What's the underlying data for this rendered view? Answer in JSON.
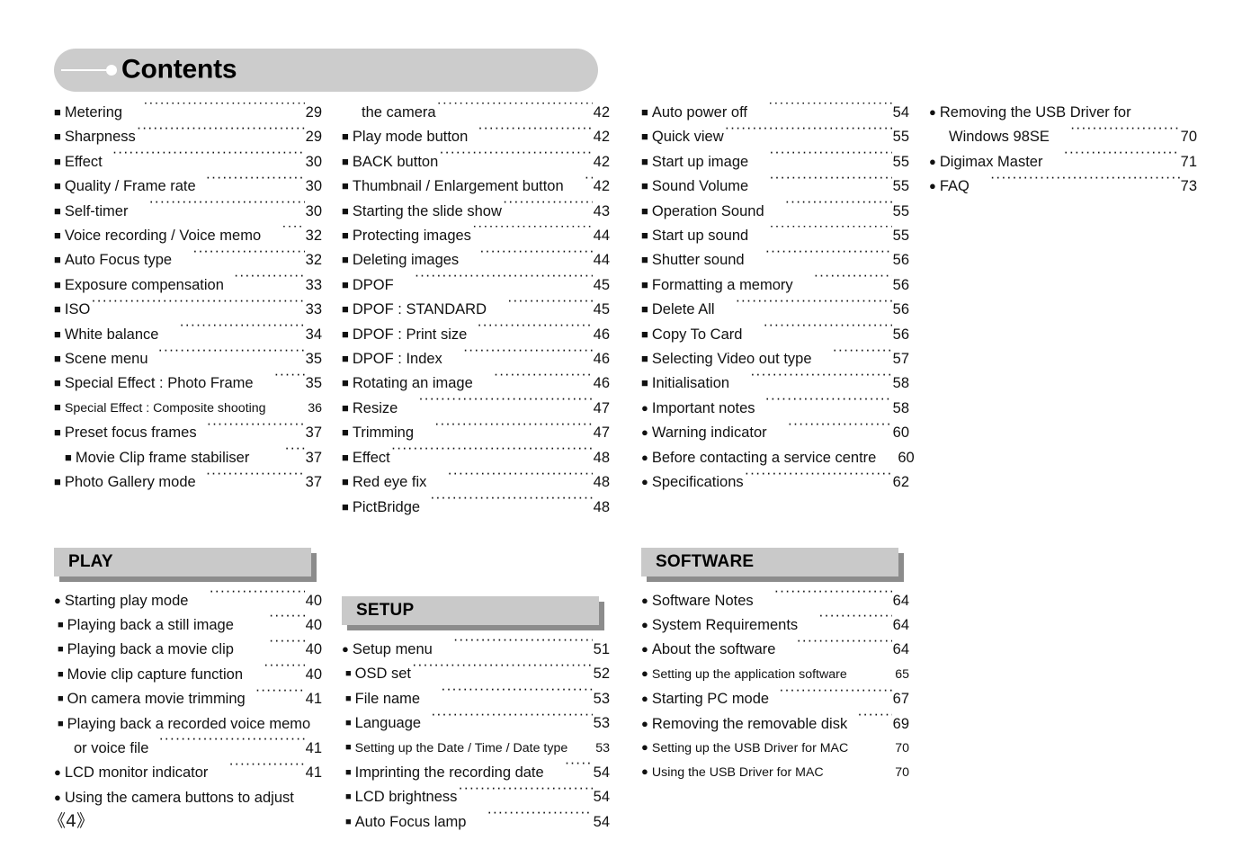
{
  "header": {
    "title": "Contents",
    "decoration": "line-dot-marker"
  },
  "footer": {
    "page_number": "《4》"
  },
  "bullets": {
    "round": "●",
    "square": "■"
  },
  "columns": [
    {
      "id": "column-1",
      "blocks": [
        {
          "type": "entries",
          "entries": [
            {
              "bullet": "square",
              "label": "Metering",
              "page": "29",
              "gap": "gap2"
            },
            {
              "bullet": "square",
              "label": "Sharpness",
              "page": "29",
              "gap": "nogap"
            },
            {
              "bullet": "square",
              "label": "Effect",
              "page": "30",
              "gap": "gap1"
            },
            {
              "bullet": "square",
              "label": "Quality / Frame rate",
              "page": "30",
              "gap": "gap1"
            },
            {
              "bullet": "square",
              "label": "Self-timer",
              "page": "30",
              "gap": "gap2"
            },
            {
              "bullet": "square",
              "label": "Voice recording / Voice memo",
              "page": "32",
              "gap": "gap2"
            },
            {
              "bullet": "square",
              "label": "Auto Focus type",
              "page": "32",
              "gap": "gap2"
            },
            {
              "bullet": "square",
              "label": "Exposure compensation",
              "page": "33",
              "gap": "gap1"
            },
            {
              "bullet": "square",
              "label": "ISO",
              "page": "33",
              "gap": "nogap"
            },
            {
              "bullet": "square",
              "label": "White balance",
              "page": "34",
              "gap": "gap2"
            },
            {
              "bullet": "square",
              "label": "Scene menu",
              "page": "35",
              "gap": "gap1"
            },
            {
              "bullet": "square",
              "label": "Special Effect : Photo Frame",
              "page": "35",
              "gap": "gap2"
            },
            {
              "bullet": "square",
              "label": "Special Effect : Composite shooting",
              "page": "36",
              "gap": "gap1",
              "small": true
            },
            {
              "bullet": "square",
              "label": "Preset focus frames",
              "page": "37",
              "gap": "gap1"
            },
            {
              "bullet": "square",
              "label": "Movie Clip frame stabiliser",
              "page": "37",
              "gap": "gap3",
              "indent": true
            },
            {
              "bullet": "square",
              "label": "Photo Gallery mode",
              "page": "37",
              "gap": "gap1"
            }
          ]
        },
        {
          "type": "section",
          "title": "PLAY",
          "entries": [
            {
              "bullet": "round",
              "label": "Starting play mode",
              "page": "40",
              "gap": "gap2"
            },
            {
              "bullet": "square",
              "label": "Playing back a still image",
              "page": "40",
              "gap": "gap3",
              "sub": true
            },
            {
              "bullet": "square",
              "label": "Playing back a movie clip",
              "page": "40",
              "gap": "gap3",
              "sub": true
            },
            {
              "bullet": "square",
              "label": "Movie clip capture function",
              "page": "40",
              "gap": "gap2",
              "sub": true
            },
            {
              "bullet": "square",
              "label": "On camera movie trimming",
              "page": "41",
              "gap": "gap1",
              "sub": true
            },
            {
              "bullet": "square",
              "label": "Playing back a recorded voice memo",
              "page": "",
              "gap": "nogap",
              "sub": true,
              "noleader": true
            },
            {
              "bullet": "none",
              "label": "or voice file",
              "page": "41",
              "gap": "gap1",
              "cont": true
            },
            {
              "bullet": "round",
              "label": "LCD monitor indicator",
              "page": "41",
              "gap": "gap2"
            },
            {
              "bullet": "round",
              "label": "Using the camera buttons to adjust",
              "page": "",
              "gap": "nogap",
              "noleader": true
            }
          ]
        }
      ]
    },
    {
      "id": "column-2",
      "blocks": [
        {
          "type": "entries",
          "entries": [
            {
              "bullet": "none",
              "label": "the camera",
              "page": "42",
              "gap": "nogap",
              "cont": true
            },
            {
              "bullet": "square",
              "label": "Play mode button",
              "page": "42",
              "gap": "gap1"
            },
            {
              "bullet": "square",
              "label": "BACK button",
              "page": "42",
              "gap": "nogap"
            },
            {
              "bullet": "square",
              "label": "Thumbnail / Enlargement button",
              "page": "42",
              "gap": "gap2"
            },
            {
              "bullet": "square",
              "label": "Starting the slide show",
              "page": "43",
              "gap": "nogap"
            },
            {
              "bullet": "square",
              "label": "Protecting images",
              "page": "44",
              "gap": "nogap"
            },
            {
              "bullet": "square",
              "label": "Deleting images",
              "page": "44",
              "gap": "gap2"
            },
            {
              "bullet": "square",
              "label": "DPOF",
              "page": "45",
              "gap": "gap2"
            },
            {
              "bullet": "square",
              "label": "DPOF : STANDARD",
              "page": "45",
              "gap": "gap2"
            },
            {
              "bullet": "square",
              "label": "DPOF : Print size",
              "page": "46",
              "gap": "gap1"
            },
            {
              "bullet": "square",
              "label": "DPOF : Index",
              "page": "46",
              "gap": "gap2"
            },
            {
              "bullet": "square",
              "label": "Rotating an image",
              "page": "46",
              "gap": "gap2"
            },
            {
              "bullet": "square",
              "label": "Resize",
              "page": "47",
              "gap": "gap2"
            },
            {
              "bullet": "square",
              "label": "Trimming",
              "page": "47",
              "gap": "gap2"
            },
            {
              "bullet": "square",
              "label": "Effect",
              "page": "48",
              "gap": "nogap"
            },
            {
              "bullet": "square",
              "label": "Red eye fix",
              "page": "48",
              "gap": "gap2"
            },
            {
              "bullet": "square",
              "label": "PictBridge",
              "page": "48",
              "gap": "gap1"
            }
          ]
        },
        {
          "type": "section",
          "title": "SETUP",
          "entries": [
            {
              "bullet": "round",
              "label": "Setup menu",
              "page": "51",
              "gap": "gap2"
            },
            {
              "bullet": "square",
              "label": "OSD set",
              "page": "52",
              "gap": "nogap",
              "sub": true
            },
            {
              "bullet": "square",
              "label": "File name",
              "page": "53",
              "gap": "gap2",
              "sub": true
            },
            {
              "bullet": "square",
              "label": "Language",
              "page": "53",
              "gap": "gap1",
              "sub": true
            },
            {
              "bullet": "square",
              "label": "Setting up the Date / Time / Date type",
              "page": "53",
              "gap": "gap1",
              "sub": true,
              "small": true
            },
            {
              "bullet": "square",
              "label": "Imprinting the recording date",
              "page": "54",
              "gap": "gap2",
              "sub": true
            },
            {
              "bullet": "square",
              "label": "LCD brightness",
              "page": "54",
              "gap": "nogap",
              "sub": true
            },
            {
              "bullet": "square",
              "label": "Auto Focus lamp",
              "page": "54",
              "gap": "gap2",
              "sub": true
            }
          ]
        }
      ]
    },
    {
      "id": "column-3",
      "blocks": [
        {
          "type": "entries",
          "entries": [
            {
              "bullet": "square",
              "label": "Auto power off",
              "page": "54",
              "gap": "gap2"
            },
            {
              "bullet": "square",
              "label": "Quick view",
              "page": "55",
              "gap": "nogap"
            },
            {
              "bullet": "square",
              "label": "Start up image",
              "page": "55",
              "gap": "gap2"
            },
            {
              "bullet": "square",
              "label": "Sound Volume",
              "page": "55",
              "gap": "gap2"
            },
            {
              "bullet": "square",
              "label": "Operation Sound",
              "page": "55",
              "gap": "gap2"
            },
            {
              "bullet": "square",
              "label": "Start up sound",
              "page": "55",
              "gap": "gap2"
            },
            {
              "bullet": "square",
              "label": "Shutter sound",
              "page": "56",
              "gap": "gap2"
            },
            {
              "bullet": "square",
              "label": "Formatting a memory",
              "page": "56",
              "gap": "gap2"
            },
            {
              "bullet": "square",
              "label": "Delete All",
              "page": "56",
              "gap": "gap2"
            },
            {
              "bullet": "square",
              "label": "Copy To Card",
              "page": "56",
              "gap": "gap2"
            },
            {
              "bullet": "square",
              "label": "Selecting Video out type",
              "page": "57",
              "gap": "gap2"
            },
            {
              "bullet": "square",
              "label": "Initialisation",
              "page": "58",
              "gap": "gap2"
            },
            {
              "bullet": "round",
              "label": "Important notes",
              "page": "58",
              "gap": "gap1"
            },
            {
              "bullet": "round",
              "label": "Warning indicator",
              "page": "60",
              "gap": "gap2"
            },
            {
              "bullet": "round",
              "label": "Before contacting a service centre",
              "page": "60",
              "gap": "gap2"
            },
            {
              "bullet": "round",
              "label": "Specifications",
              "page": "62",
              "gap": "nogap"
            }
          ]
        },
        {
          "type": "section",
          "title": "SOFTWARE",
          "entries": [
            {
              "bullet": "round",
              "label": "Software Notes",
              "page": "64",
              "gap": "gap2"
            },
            {
              "bullet": "round",
              "label": "System Requirements",
              "page": "64",
              "gap": "gap2"
            },
            {
              "bullet": "round",
              "label": "About the software",
              "page": "64",
              "gap": "gap2"
            },
            {
              "bullet": "round",
              "label": "Setting up the application software",
              "page": "65",
              "gap": "gap2",
              "small": true
            },
            {
              "bullet": "round",
              "label": "Starting PC mode",
              "page": "67",
              "gap": "gap1"
            },
            {
              "bullet": "round",
              "label": "Removing the removable disk",
              "page": "69",
              "gap": "gap1"
            },
            {
              "bullet": "round",
              "label": "Setting up the USB Driver for MAC",
              "page": "70",
              "gap": "gap2",
              "small": true
            },
            {
              "bullet": "round",
              "label": "Using the USB Driver for MAC",
              "page": "70",
              "gap": "gap2",
              "small": true
            }
          ]
        }
      ]
    },
    {
      "id": "column-4",
      "blocks": [
        {
          "type": "entries",
          "entries": [
            {
              "bullet": "round",
              "label": "Removing the USB Driver for",
              "page": "",
              "gap": "nogap",
              "noleader": true
            },
            {
              "bullet": "none",
              "label": "Windows 98SE",
              "page": "70",
              "gap": "gap2",
              "cont": true
            },
            {
              "bullet": "round",
              "label": "Digimax Master",
              "page": "71",
              "gap": "gap2"
            },
            {
              "bullet": "round",
              "label": "FAQ",
              "page": "73",
              "gap": "gap2"
            }
          ]
        }
      ]
    }
  ]
}
